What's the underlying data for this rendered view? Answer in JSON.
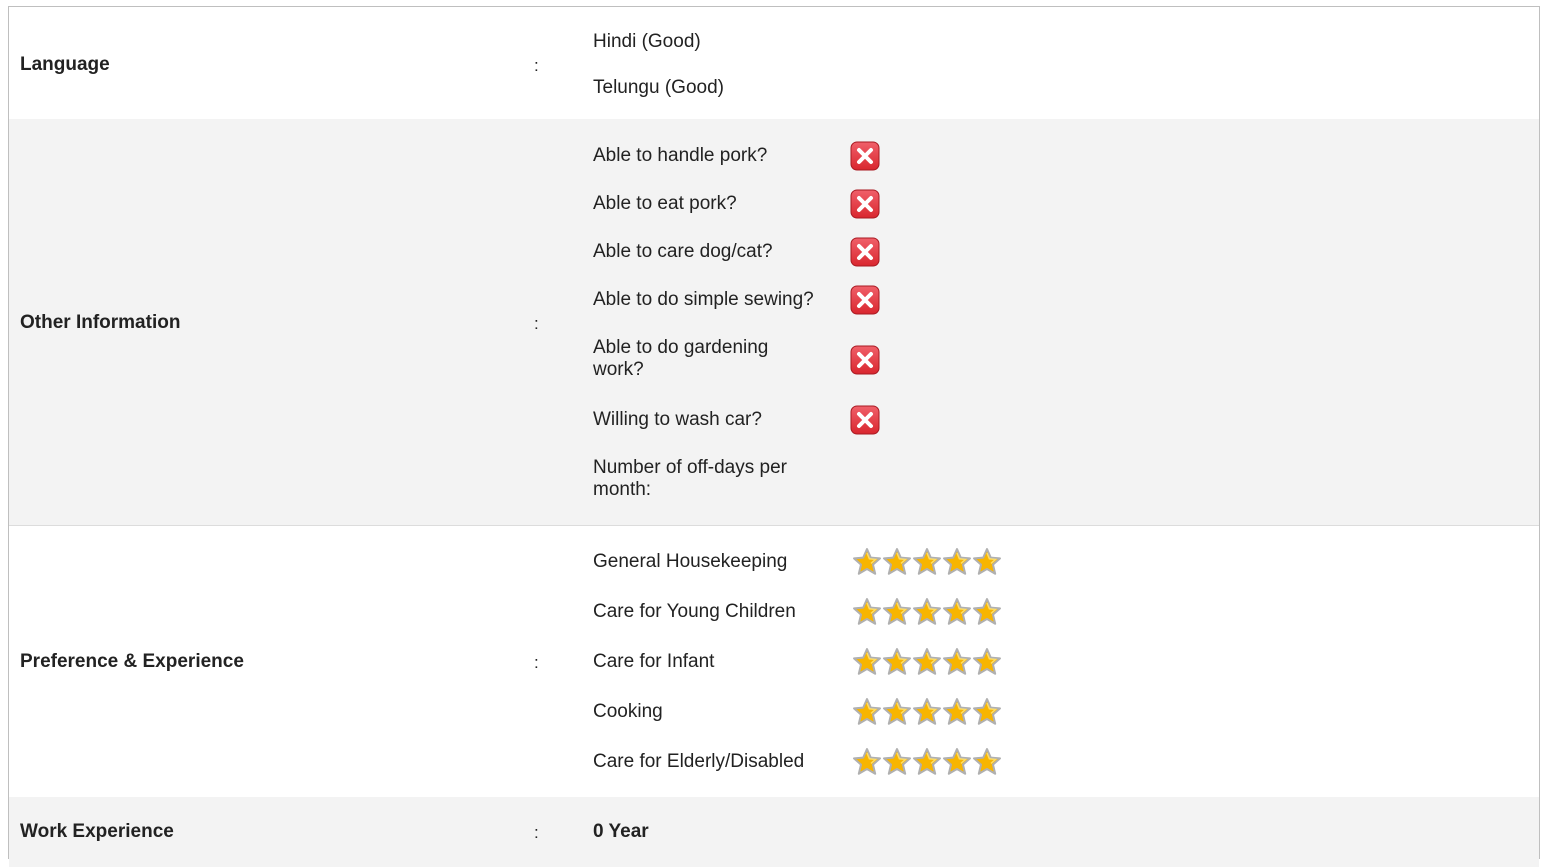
{
  "language": {
    "label": "Language",
    "colon": ":",
    "values": [
      "Hindi (Good)",
      "Telungu (Good)"
    ]
  },
  "other": {
    "label": "Other Information",
    "colon": ":",
    "questions": [
      {
        "text": "Able to handle pork?",
        "icon": "x-icon"
      },
      {
        "text": "Able to eat pork?",
        "icon": "x-icon"
      },
      {
        "text": "Able to care dog/cat?",
        "icon": "x-icon"
      },
      {
        "text": "Able to do simple sewing?",
        "icon": "x-icon"
      },
      {
        "text": "Able to do gardening work?",
        "icon": "x-icon"
      },
      {
        "text": "Willing to wash car?",
        "icon": "x-icon"
      }
    ],
    "offdays_label": "Number of off-days per month:"
  },
  "preference": {
    "label": "Preference & Experience",
    "colon": ":",
    "skills": [
      {
        "name": "General Housekeeping",
        "rating": 5,
        "max": 5
      },
      {
        "name": "Care for Young Children",
        "rating": 5,
        "max": 5
      },
      {
        "name": "Care for Infant",
        "rating": 5,
        "max": 5
      },
      {
        "name": "Cooking",
        "rating": 5,
        "max": 5
      },
      {
        "name": "Care for Elderly/Disabled",
        "rating": 5,
        "max": 5
      }
    ]
  },
  "work": {
    "label": "Work Experience",
    "colon": ":",
    "value": "0 Year"
  },
  "colors": {
    "alt_row": "#f3f3f3",
    "x_red": "#d9262e",
    "star_gold": "#f7b500"
  }
}
